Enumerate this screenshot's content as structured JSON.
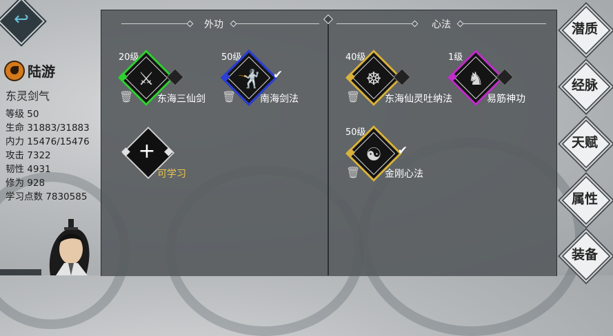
{
  "character": {
    "name": "陆游",
    "sect": "东灵剑气",
    "stats": [
      "等级 50",
      "生命 31883/31883",
      "内力 15476/15476",
      "攻击 7322",
      "韧性 4931",
      "修为 928",
      "学习点数 7830585"
    ]
  },
  "panel": {
    "left_title": "外功",
    "right_title": "心法"
  },
  "skills": {
    "s1": {
      "level": "20级",
      "name": "东海三仙剑",
      "icon": "swordsman-figure-icon",
      "color": "#2fd12f"
    },
    "s2": {
      "level": "50级",
      "name": "南海剑法",
      "icon": "sword-dancer-icon",
      "color": "#2b3fd8"
    },
    "s3": {
      "level": "",
      "name": "可学习",
      "icon": "plus-icon"
    },
    "s4": {
      "level": "40级",
      "name": "东海仙灵吐纳法",
      "icon": "meditating-figure-icon",
      "color": "#d9b23c"
    },
    "s5": {
      "level": "1级",
      "name": "易筋神功",
      "icon": "monk-figure-icon",
      "color": "#c02fc9"
    },
    "s6": {
      "level": "50级",
      "name": "金刚心法",
      "icon": "buddha-figure-icon",
      "color": "#d9b23c"
    }
  },
  "side_tabs": [
    "潜质",
    "经脉",
    "天赋",
    "属性",
    "装备"
  ]
}
